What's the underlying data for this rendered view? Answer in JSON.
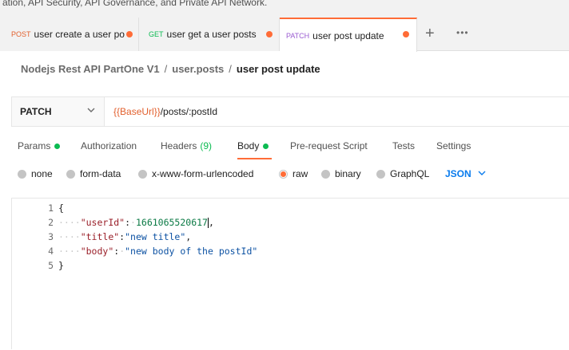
{
  "page_top_text": "ation, API Security, API Governance, and Private API Network.",
  "tabs": [
    {
      "method": "POST",
      "method_color": "#e2602e",
      "label": "user create a user po",
      "unsaved": true
    },
    {
      "method": "GET",
      "method_color": "#0cbb52",
      "label": "user get a user posts",
      "unsaved": true
    },
    {
      "method": "PATCH",
      "method_color": "#9a5bd1",
      "label": "user post update",
      "unsaved": true,
      "active": true
    }
  ],
  "tabbar": {
    "add_label": "+",
    "more_label": "•••"
  },
  "breadcrumb": {
    "collection": "Nodejs Rest API PartOne V1",
    "folder": "user.posts",
    "request": "user post update",
    "separator": "/"
  },
  "request": {
    "method": "PATCH",
    "url_var": "{{BaseUrl}}",
    "url_path": "/posts/:postId"
  },
  "request_tabs": {
    "params": "Params",
    "authorization": "Authorization",
    "headers": "Headers",
    "headers_count": "(9)",
    "body": "Body",
    "prerequest": "Pre-request Script",
    "tests": "Tests",
    "settings": "Settings",
    "active": "Body"
  },
  "body_modes": {
    "none": "none",
    "form_data": "form-data",
    "urlencoded": "x-www-form-urlencoded",
    "raw": "raw",
    "binary": "binary",
    "graphql": "GraphQL",
    "selected": "raw",
    "format": "JSON"
  },
  "editor": {
    "line_numbers": [
      "1",
      "2",
      "3",
      "4",
      "5"
    ],
    "open_brace": "{",
    "close_brace": "}",
    "key1": "\"userId\"",
    "val1": "1661065520617",
    "key2": "\"title\"",
    "val2": "\"new title\"",
    "key3": "\"body\"",
    "val3": "\"new body of the postId\""
  },
  "colors": {
    "accent": "#ff6c37",
    "link": "#097bed",
    "success": "#0cbb52"
  }
}
